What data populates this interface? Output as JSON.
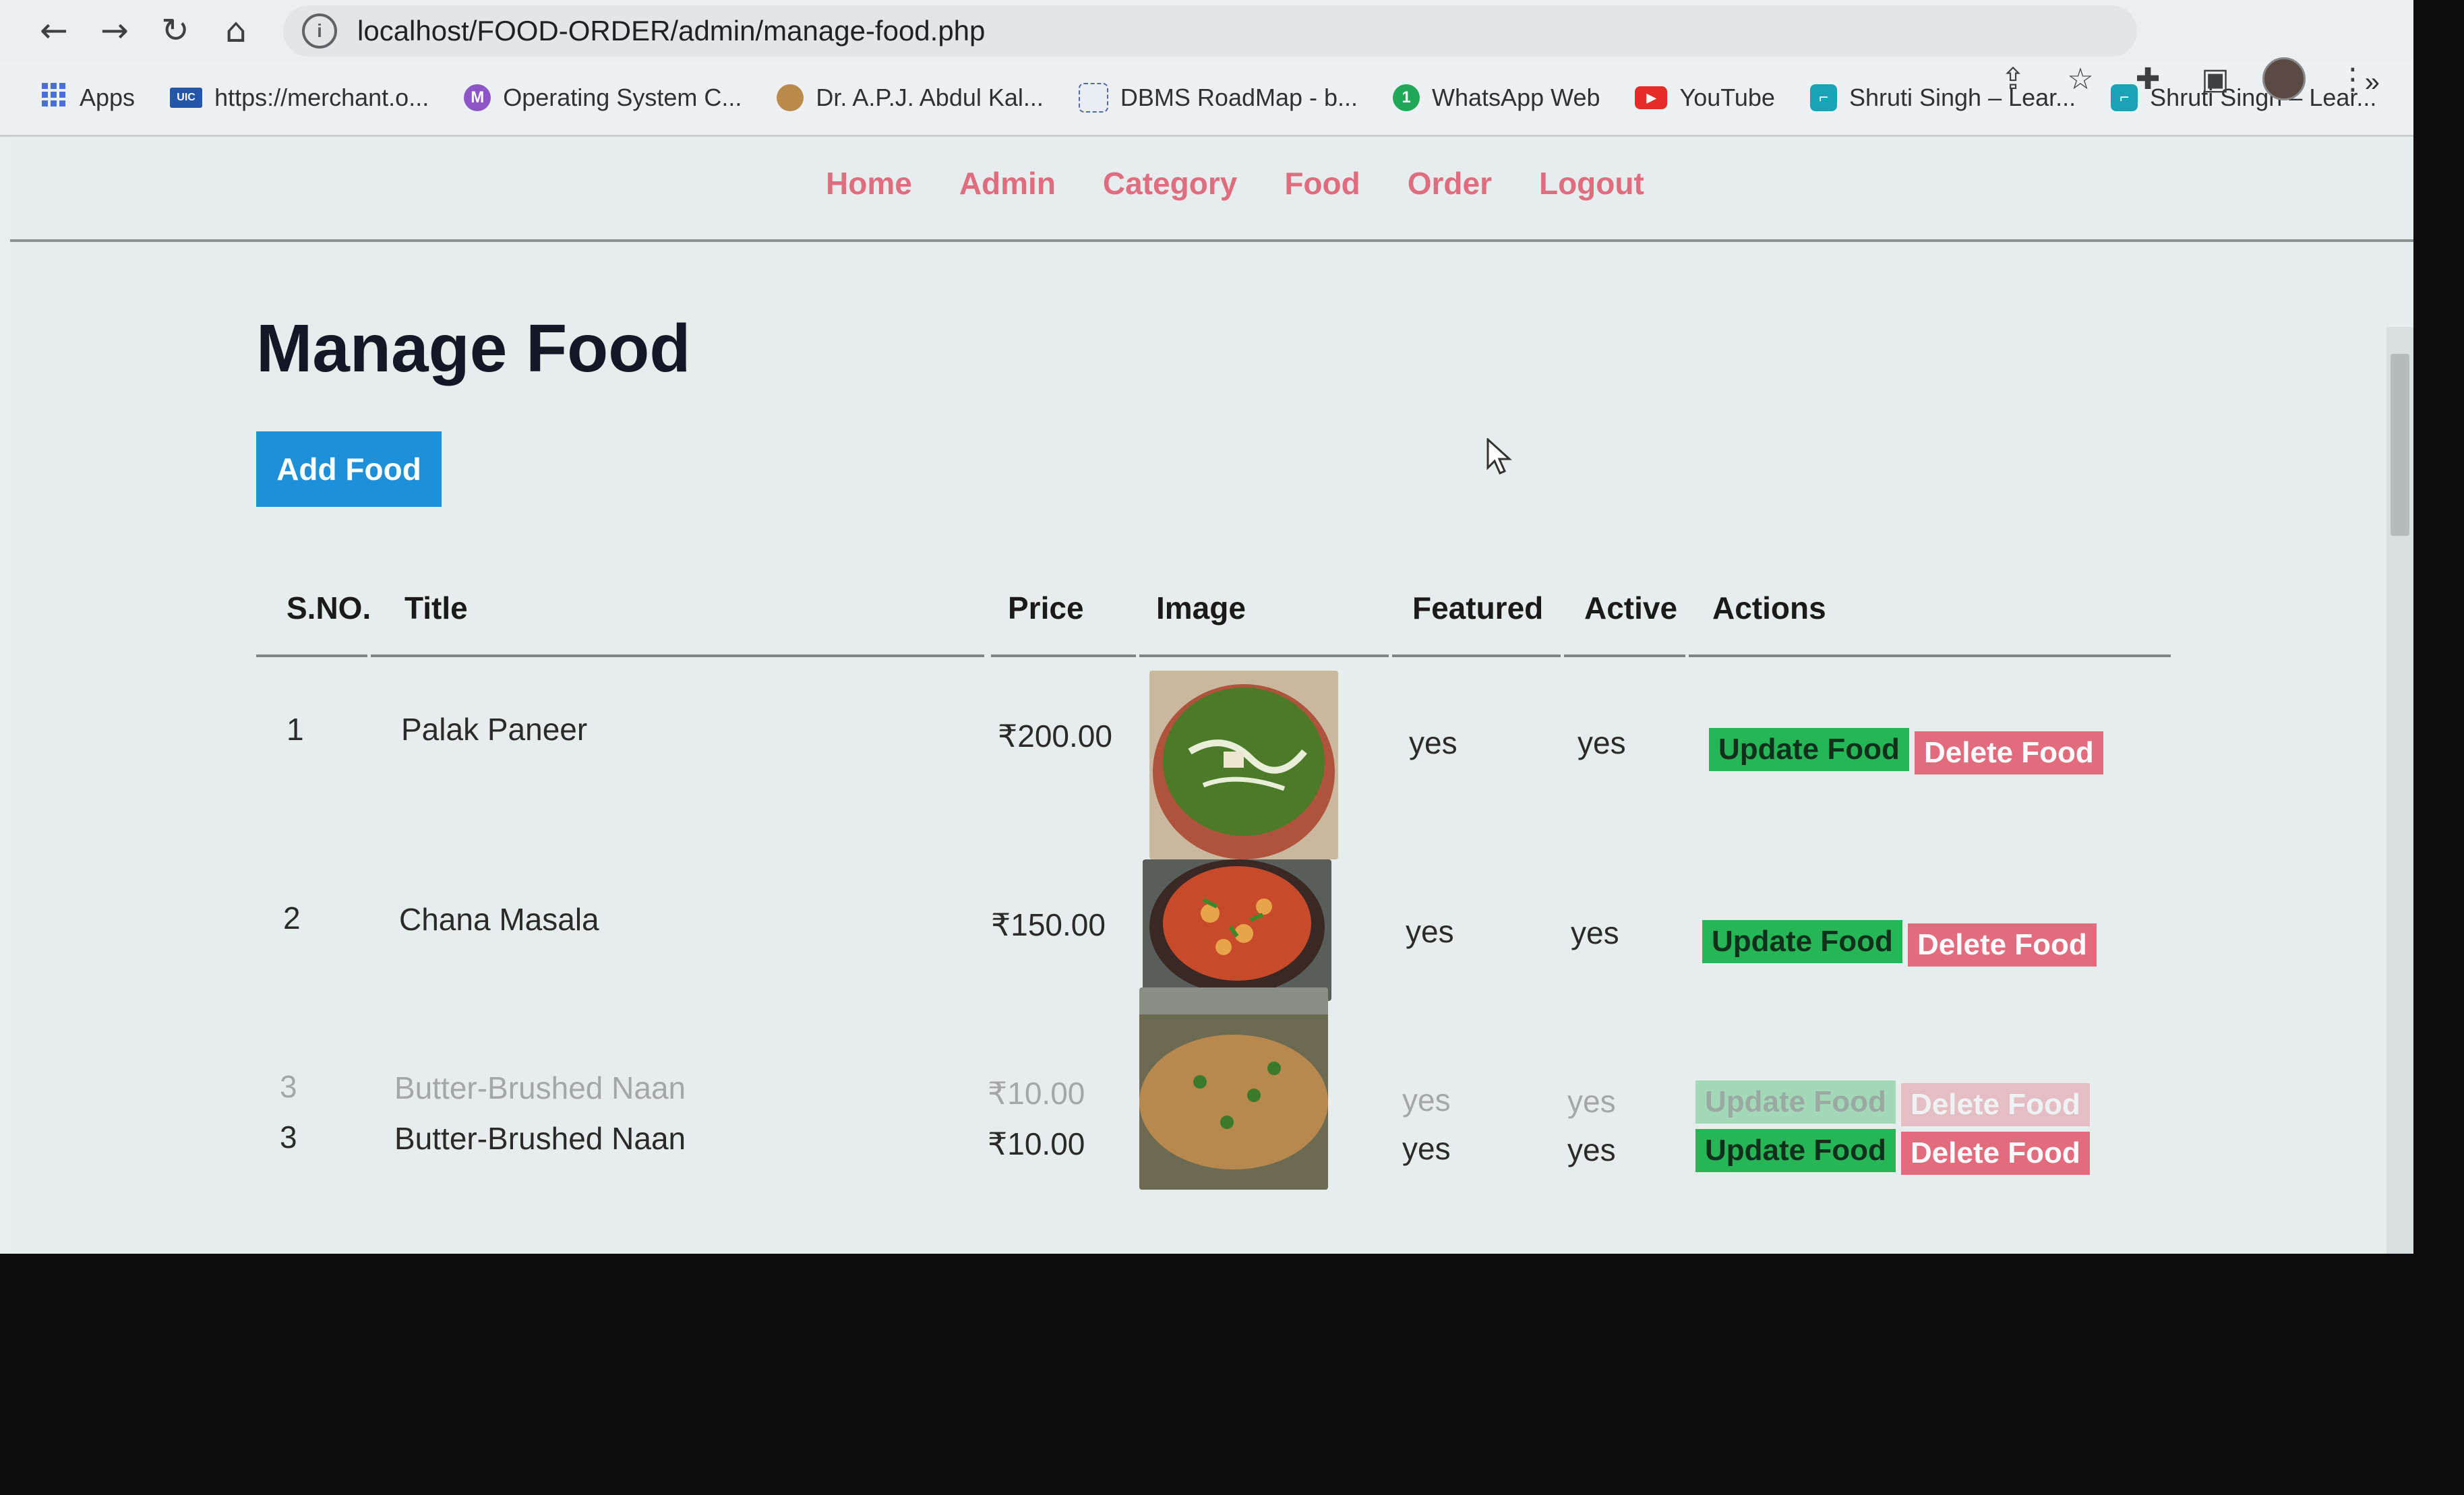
{
  "browser": {
    "url": "localhost/FOOD-ORDER/admin/manage-food.php",
    "nav": {
      "back": "←",
      "forward": "→",
      "reload": "↻",
      "home": "⌂"
    },
    "bookmarks": [
      {
        "label": "Apps",
        "icon": "apps-grid-icon"
      },
      {
        "label": "https://merchant.o...",
        "icon": "merchant-icon"
      },
      {
        "label": "Operating System C...",
        "icon": "m-badge-icon"
      },
      {
        "label": "Dr. A.P.J. Abdul Kal...",
        "icon": "emblem-icon"
      },
      {
        "label": "DBMS RoadMap - b...",
        "icon": "roadmap-icon"
      },
      {
        "label": "WhatsApp Web",
        "icon": "whatsapp-icon"
      },
      {
        "label": "YouTube",
        "icon": "youtube-icon"
      },
      {
        "label": "Shruti Singh – Lear...",
        "icon": "site-icon"
      },
      {
        "label": "Shruti Singh – Lear...",
        "icon": "site-icon"
      }
    ],
    "bookmarks_more": "»"
  },
  "nav": {
    "items": [
      "Home",
      "Admin",
      "Category",
      "Food",
      "Order",
      "Logout"
    ]
  },
  "page": {
    "title": "Manage Food",
    "add_button": "Add Food"
  },
  "table": {
    "headers": {
      "sno": "S.NO.",
      "title": "Title",
      "price": "Price",
      "image": "Image",
      "featured": "Featured",
      "active": "Active",
      "actions": "Actions"
    },
    "rows": [
      {
        "sno": "1",
        "title": "Palak Paneer",
        "price": "₹200.00",
        "featured": "yes",
        "active": "yes",
        "update": "Update Food",
        "delete": "Delete Food"
      },
      {
        "sno": "2",
        "title": "Chana Masala",
        "price": "₹150.00",
        "featured": "yes",
        "active": "yes",
        "update": "Update Food",
        "delete": "Delete Food"
      },
      {
        "sno": "3",
        "title": "Butter-Brushed Naan",
        "price": "₹10.00",
        "featured": "yes",
        "active": "yes",
        "update": "Update Food",
        "delete": "Delete Food"
      }
    ]
  },
  "colors": {
    "nav_link": "#e06d7f",
    "add_button": "#1e90d9",
    "update_button": "#27b657",
    "delete_button": "#e26c7d"
  }
}
